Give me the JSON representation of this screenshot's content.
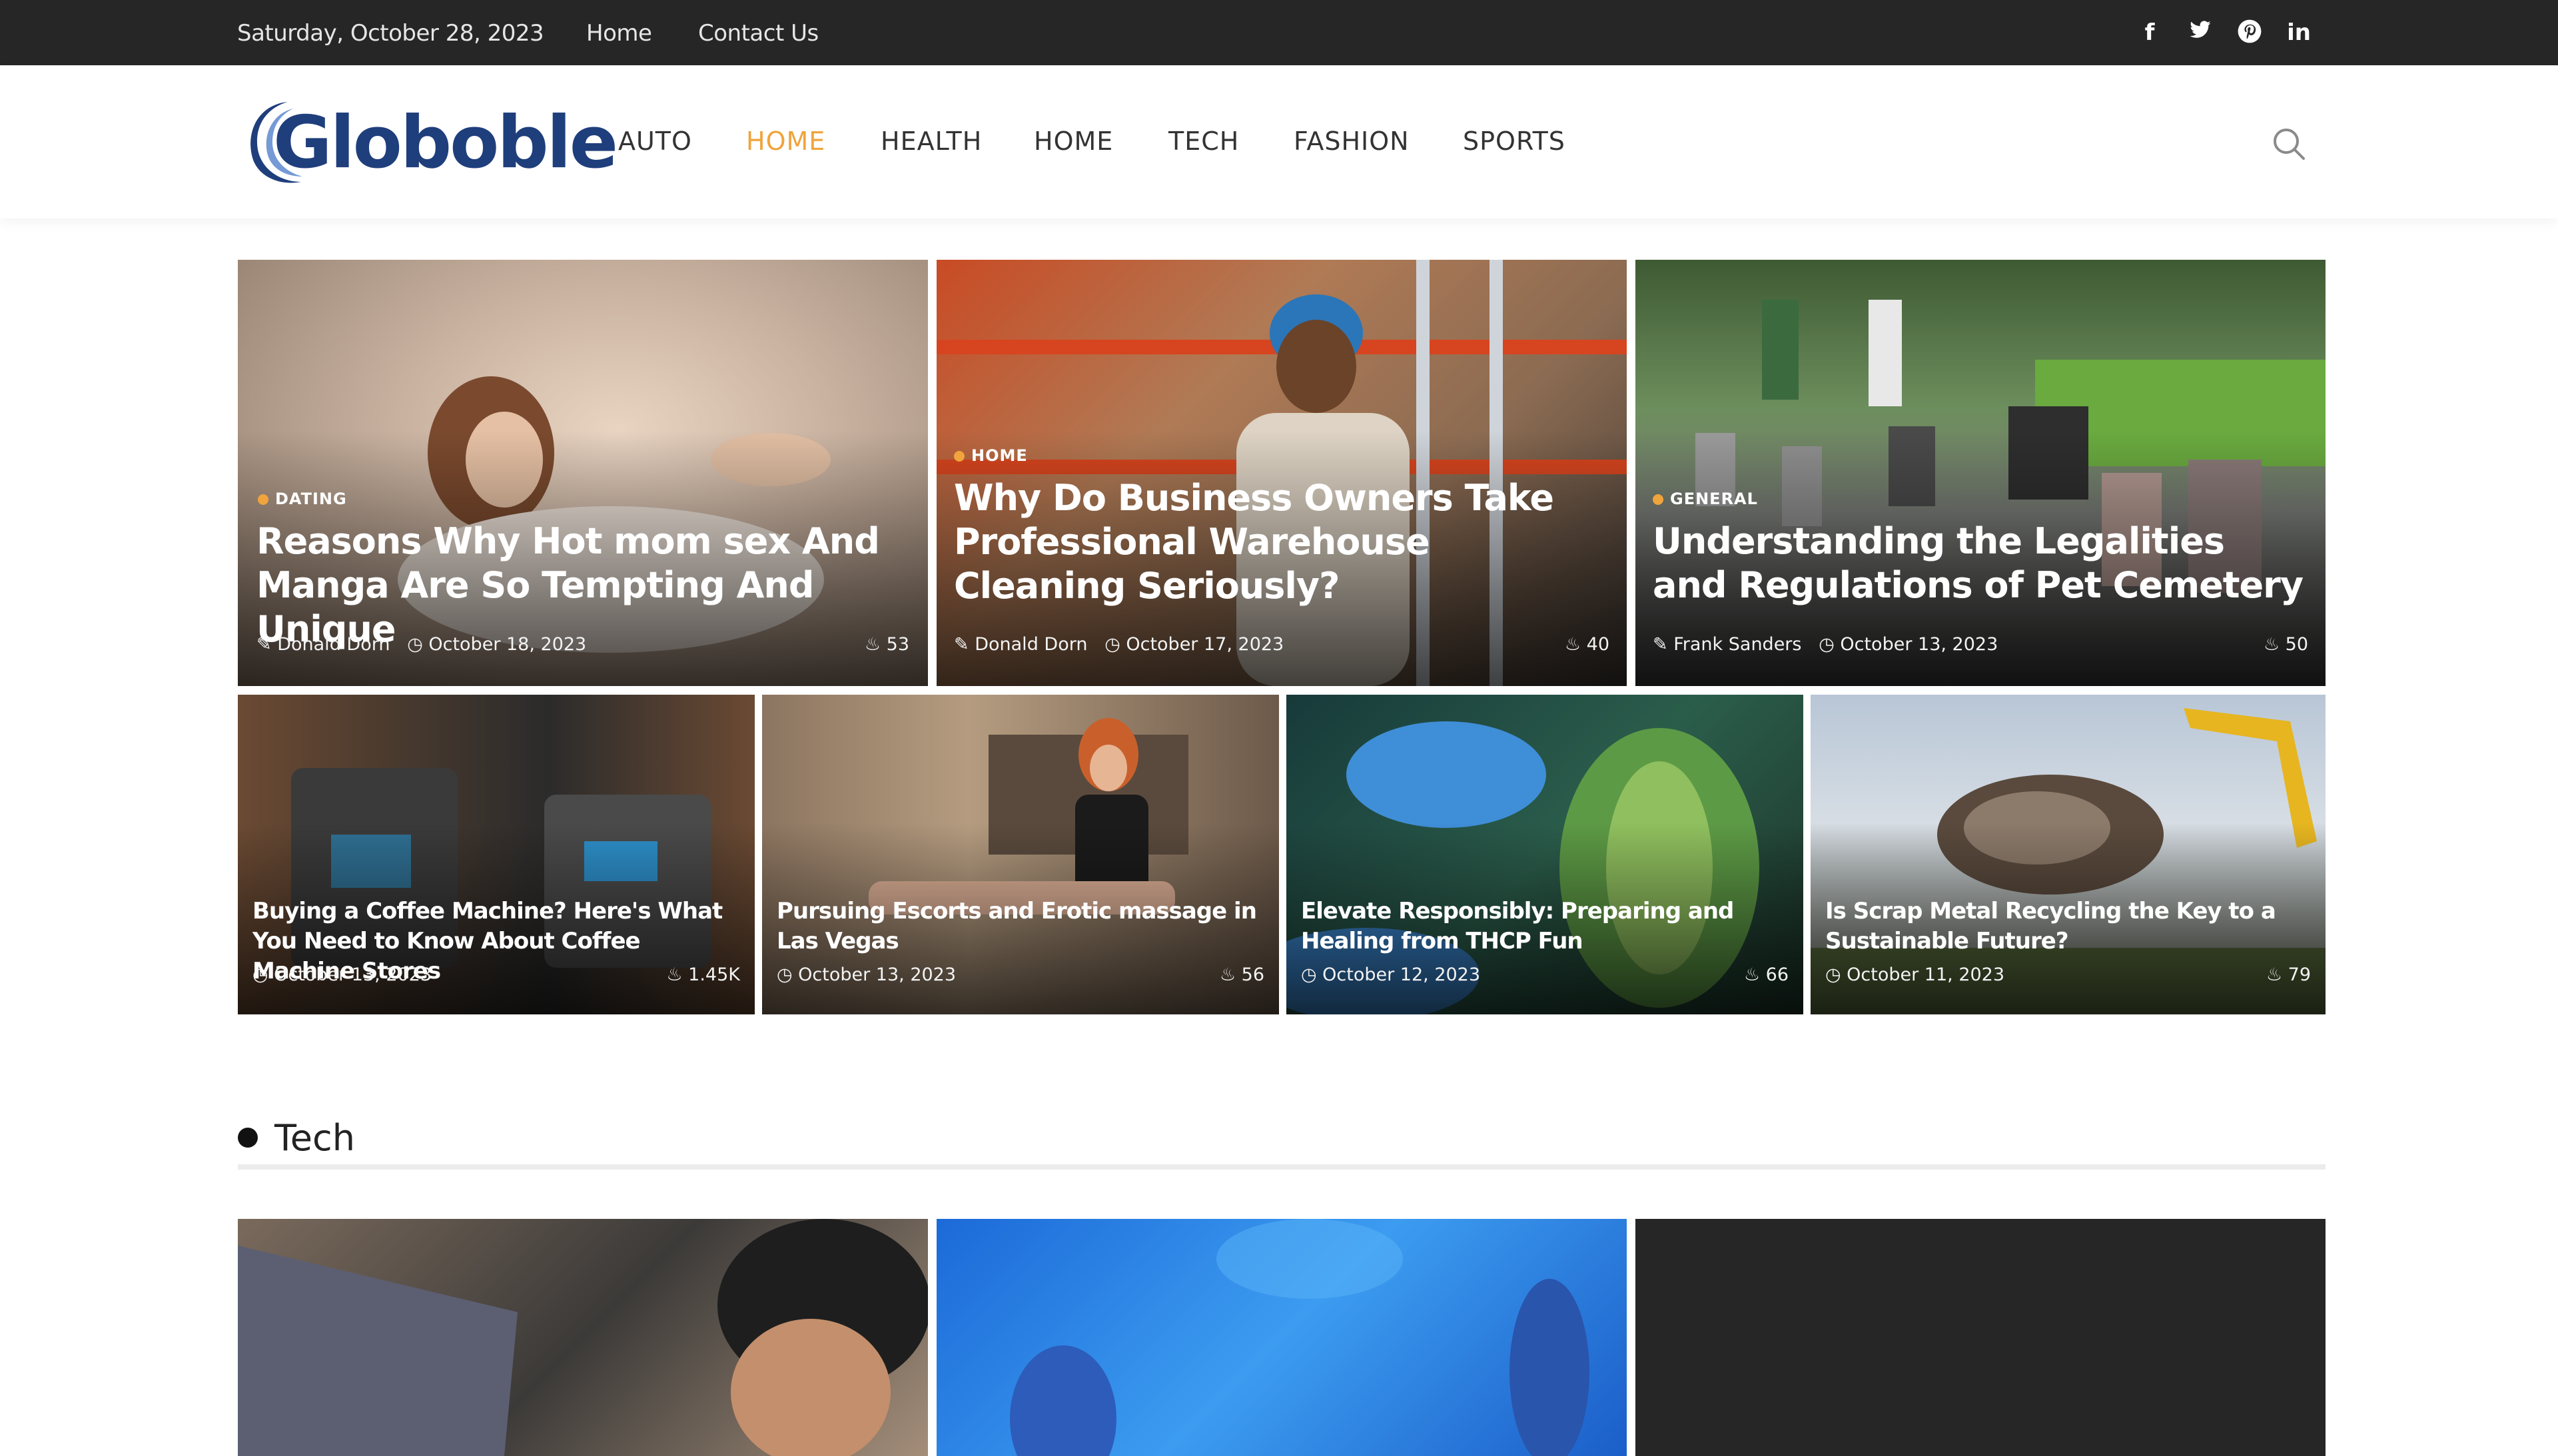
{
  "topbar": {
    "date": "Saturday, October 28, 2023",
    "links": [
      "Home",
      "Contact Us"
    ],
    "social_icons": [
      "facebook-icon",
      "twitter-icon",
      "pinterest-icon",
      "linkedin-icon"
    ]
  },
  "header": {
    "logo_text": "Globoble",
    "nav": [
      "AUTO",
      "HOME",
      "HEALTH",
      "HOME",
      "TECH",
      "FASHION",
      "SPORTS"
    ],
    "active_nav_index": 1,
    "search_icon": "search-icon"
  },
  "featured": [
    {
      "category": "DATING",
      "title": "Reasons Why Hot mom sex And Manga Are So Tempting And Unique",
      "author": "Donald Dorn",
      "date": "October 18, 2023",
      "views": "53"
    },
    {
      "category": "HOME",
      "title": "Why Do Business Owners Take Professional Warehouse Cleaning Seriously?",
      "author": "Donald Dorn",
      "date": "October 17, 2023",
      "views": "40"
    },
    {
      "category": "GENERAL",
      "title": "Understanding the Legalities and Regulations of Pet Cemetery",
      "author": "Frank Sanders",
      "date": "October 13, 2023",
      "views": "50"
    }
  ],
  "secondary": [
    {
      "title": "Buying a Coffee Machine? Here's What You Need to Know About Coffee Machine Stores",
      "date": "October 13, 2023",
      "views": "1.45K"
    },
    {
      "title": "Pursuing Escorts and Erotic massage in Las Vegas",
      "date": "October 13, 2023",
      "views": "56"
    },
    {
      "title": "Elevate Responsibly: Preparing and Healing from THCP Fun",
      "date": "October 12, 2023",
      "views": "66"
    },
    {
      "title": "Is Scrap Metal Recycling the Key to a Sustainable Future?",
      "date": "October 11, 2023",
      "views": "79"
    }
  ],
  "section": {
    "title": "Tech"
  },
  "colors": {
    "accent": "#f0a43b",
    "topbar": "#262626",
    "logo": "#1f3e7c"
  }
}
